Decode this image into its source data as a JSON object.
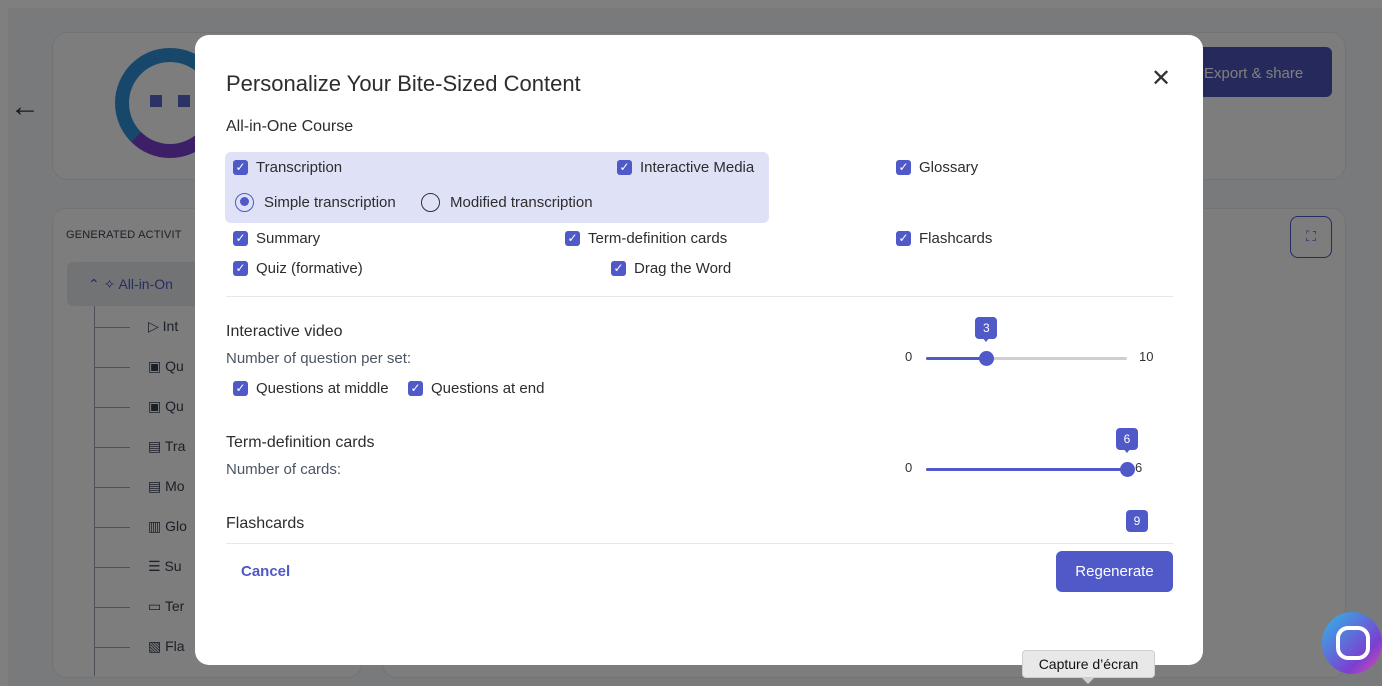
{
  "background": {
    "export_label": "Export & share",
    "generated_title": "GENERATED ACTIVIT",
    "active_item": "All-in-On",
    "tree_items": [
      "Int",
      "Qu",
      "Qu",
      "Tra",
      "Mo",
      "Glo",
      "Su",
      "Ter",
      "Fla"
    ]
  },
  "modal": {
    "title": "Personalize Your Bite-Sized Content",
    "section_label": "All-in-One Course",
    "checkboxes": {
      "transcription": "Transcription",
      "interactive_media": "Interactive Media",
      "glossary": "Glossary",
      "summary": "Summary",
      "term_definition_cards": "Term-definition cards",
      "flashcards": "Flashcards",
      "quiz_formative": "Quiz (formative)",
      "drag_the_word": "Drag the Word"
    },
    "radios": {
      "simple": "Simple transcription",
      "modified": "Modified transcription"
    },
    "interactive_video": {
      "title": "Interactive video",
      "subtitle": "Number of question per set:",
      "q_middle": "Questions at middle",
      "q_end": "Questions at end",
      "slider": {
        "min": "0",
        "max": "10",
        "value": 3
      }
    },
    "term_cards": {
      "title": "Term-definition cards",
      "subtitle": "Number of cards:",
      "slider": {
        "min": "0",
        "max": "6",
        "value": 6
      }
    },
    "flashcards": {
      "title": "Flashcards",
      "slider": {
        "value": 9
      }
    },
    "cancel_label": "Cancel",
    "regenerate_label": "Regenerate"
  },
  "tooltip": "Capture d’écran",
  "colors": {
    "accent": "#4f59c7",
    "highlight": "#dfe1f7",
    "overlay": "rgba(0,0,0,0.5)"
  }
}
